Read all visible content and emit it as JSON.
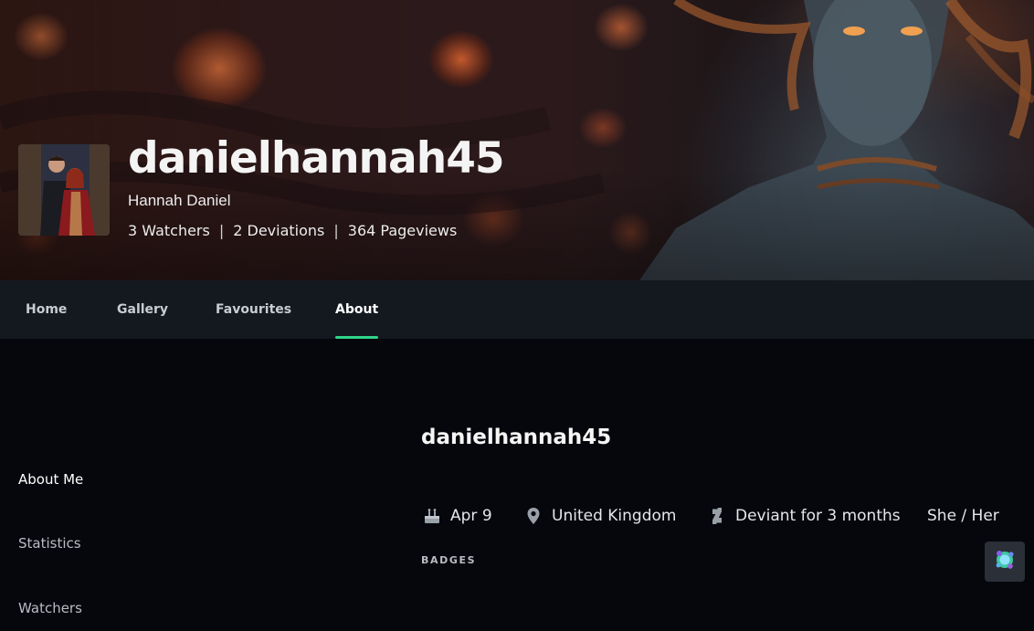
{
  "profile": {
    "username": "danielhannah45",
    "real_name": "Hannah Daniel",
    "watchers": "3 Watchers",
    "deviations": "2 Deviations",
    "pageviews": "364 Pageviews",
    "separator": "|"
  },
  "nav": {
    "tabs": [
      {
        "label": "Home"
      },
      {
        "label": "Gallery"
      },
      {
        "label": "Favourites"
      },
      {
        "label": "About",
        "active": true
      }
    ],
    "active_color": "#2fd48a"
  },
  "sidebar": {
    "items": [
      {
        "label": "About Me",
        "active": true
      },
      {
        "label": "Statistics"
      },
      {
        "label": "Watchers"
      }
    ]
  },
  "about": {
    "title": "danielhannah45",
    "birthday": {
      "icon": "cake-icon",
      "text": "Apr 9"
    },
    "location": {
      "icon": "location-pin-icon",
      "text": "United Kingdom"
    },
    "deviant_since": {
      "icon": "deviantart-logo-icon",
      "text": "Deviant for 3 months"
    },
    "pronouns": "She / Her",
    "badges_label": "BADGES"
  },
  "floating_button": {
    "icon": "gem-badge-icon"
  }
}
